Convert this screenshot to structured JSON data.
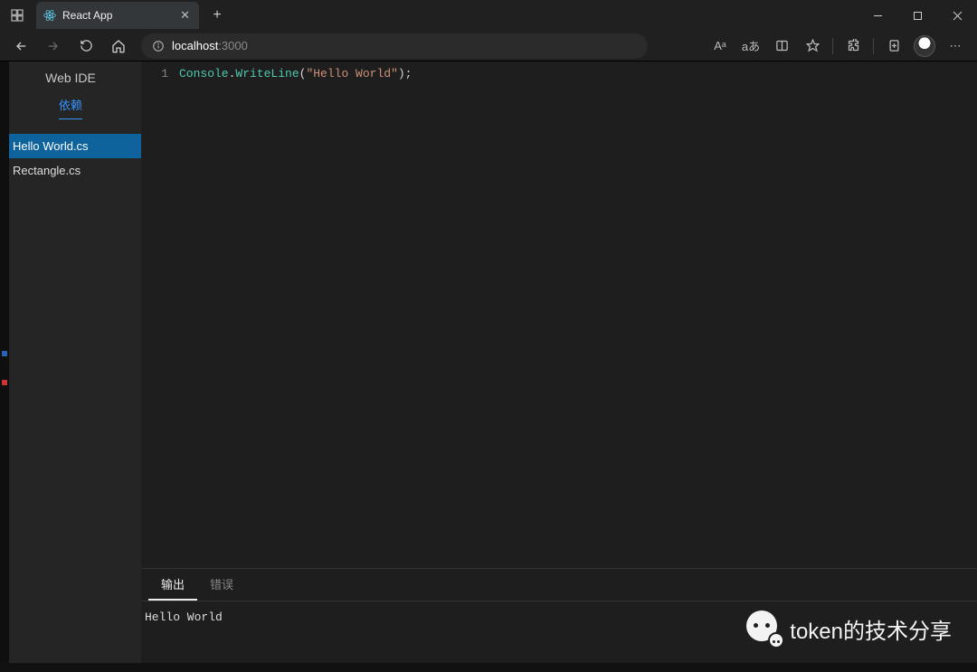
{
  "browser": {
    "tab_title": "React App",
    "url_host": "localhost",
    "url_port": ":3000",
    "toolbar_right": [
      "Aᵃ",
      "aあ",
      "sidebar-icon",
      "favorites-icon",
      "extensions-icon",
      "collections-icon"
    ]
  },
  "sidebar": {
    "title": "Web IDE",
    "subtitle": "依赖",
    "files": [
      {
        "name": "Hello World.cs",
        "active": true
      },
      {
        "name": "Rectangle.cs",
        "active": false
      }
    ]
  },
  "editor": {
    "line_number": "1",
    "code_tokens": {
      "t1": "Console",
      "t2": ".",
      "t3": "WriteLine",
      "t4": "(",
      "t5": "\"Hello World\"",
      "t6": ");"
    }
  },
  "output": {
    "tabs": [
      {
        "label": "输出",
        "active": true
      },
      {
        "label": "错误",
        "active": false
      }
    ],
    "text": "Hello World"
  },
  "watermark": "token的技术分享"
}
